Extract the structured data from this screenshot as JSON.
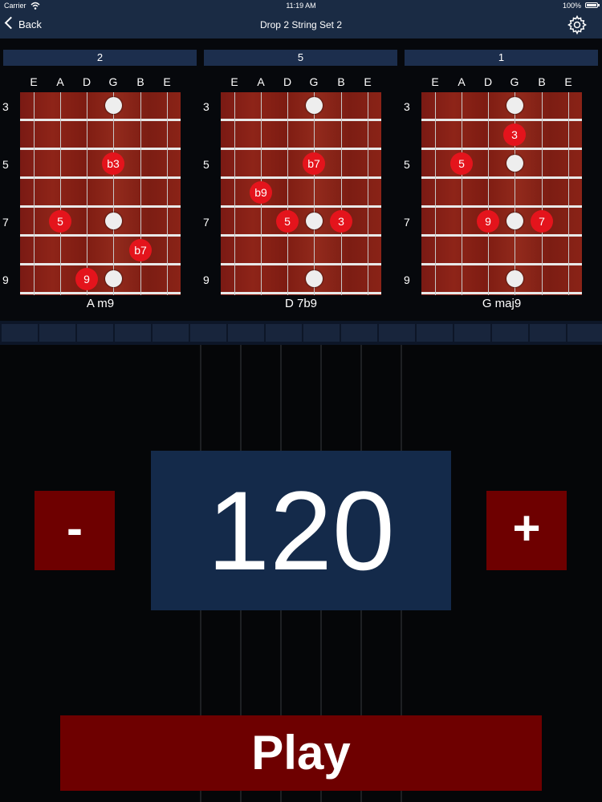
{
  "status": {
    "carrier": "Carrier",
    "time": "11:19 AM",
    "battery": "100%"
  },
  "nav": {
    "back_label": "Back",
    "title": "Drop 2 String Set 2"
  },
  "strings": [
    "E",
    "A",
    "D",
    "G",
    "B",
    "E"
  ],
  "frets": [
    "3",
    "5",
    "7",
    "9"
  ],
  "panels": [
    {
      "header": "2",
      "chord": "A m9",
      "notes": [
        {
          "label": "b3",
          "string": 3,
          "fret": 5
        },
        {
          "label": "5",
          "string": 1,
          "fret": 7
        },
        {
          "label": "b7",
          "string": 4,
          "fret": 8
        },
        {
          "label": "9",
          "string": 2,
          "fret": 9
        }
      ]
    },
    {
      "header": "5",
      "chord": "D 7b9",
      "notes": [
        {
          "label": "b7",
          "string": 3,
          "fret": 5
        },
        {
          "label": "b9",
          "string": 1,
          "fret": 6
        },
        {
          "label": "5",
          "string": 2,
          "fret": 7
        },
        {
          "label": "3",
          "string": 4,
          "fret": 7
        }
      ]
    },
    {
      "header": "1",
      "chord": "G maj9",
      "notes": [
        {
          "label": "3",
          "string": 3,
          "fret": 4
        },
        {
          "label": "5",
          "string": 1,
          "fret": 5
        },
        {
          "label": "9",
          "string": 2,
          "fret": 7
        },
        {
          "label": "7",
          "string": 4,
          "fret": 7
        }
      ]
    }
  ],
  "tempo": {
    "minus_label": "-",
    "value": "120",
    "plus_label": "+"
  },
  "play_label": "Play",
  "colors": {
    "bar": "#1a2b44",
    "note": "#e4141c",
    "button": "#6e0000",
    "tempo_bg": "#142a4a"
  }
}
